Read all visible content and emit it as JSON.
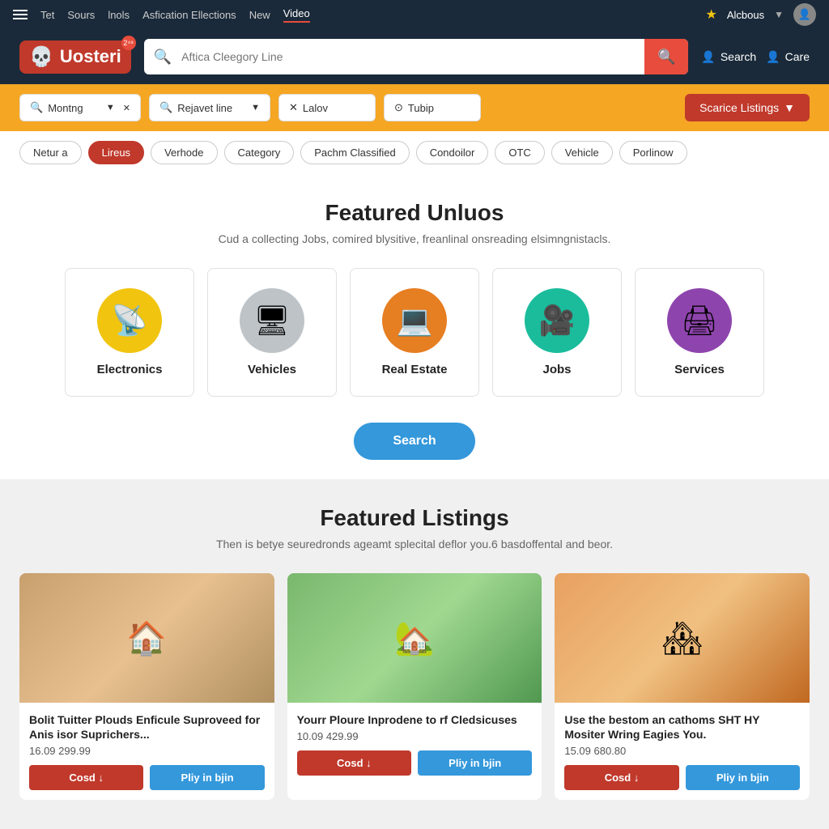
{
  "topnav": {
    "hamburger_label": "menu",
    "items": [
      {
        "label": "Tet",
        "active": false
      },
      {
        "label": "Sours",
        "active": false
      },
      {
        "label": "lnols",
        "active": false
      },
      {
        "label": "Asfication Ellections",
        "active": false
      },
      {
        "label": "New",
        "active": false
      },
      {
        "label": "Video",
        "active": true
      }
    ],
    "user_name": "Alcbous",
    "star_icon": "★"
  },
  "header": {
    "logo_text": "Uosteri",
    "logo_badge": "2⁴⁹",
    "search_placeholder": "Aftica Cleegory Line",
    "search_icon": "🔍",
    "search_button_icon": "🔍",
    "action_search_label": "Search",
    "action_care_label": "Care"
  },
  "filterbar": {
    "location_label": "Montng",
    "location_icon": "🔍",
    "category_label": "Rejavet line",
    "category_icon": "🔍",
    "condition_label": "Lalov",
    "condition_icon": "✕",
    "price_label": "Tubip",
    "price_icon": "⊙",
    "submit_label": "Scarice Listings",
    "chevron": "▼"
  },
  "tags": [
    {
      "label": "Netur a",
      "active": false
    },
    {
      "label": "Lireus",
      "active": true
    },
    {
      "label": "Verhode",
      "active": false
    },
    {
      "label": "Category",
      "active": false
    },
    {
      "label": "Pachm Classified",
      "active": false
    },
    {
      "label": "Condoilor",
      "active": false
    },
    {
      "label": "OTC",
      "active": false
    },
    {
      "label": "Vehicle",
      "active": false
    },
    {
      "label": "Porlinow",
      "active": false
    }
  ],
  "featured": {
    "title": "Featured Unluos",
    "subtitle": "Cud a collecting Jobs, comired blysitive, freanlinal onsreading elsimngnistacls.",
    "categories": [
      {
        "label": "Electronics",
        "color_class": "cat-yellow",
        "icon": "📡"
      },
      {
        "label": "Vehicles",
        "color_class": "cat-gray",
        "icon": "🖥"
      },
      {
        "label": "Real Estate",
        "color_class": "cat-orange",
        "icon": "💻"
      },
      {
        "label": "Jobs",
        "color_class": "cat-teal",
        "icon": "🎥"
      },
      {
        "label": "Services",
        "color_class": "cat-purple",
        "icon": "🖨"
      }
    ],
    "search_btn_label": "Search"
  },
  "listings": {
    "title": "Featured Listings",
    "subtitle": "Then is betye seuredronds ageamt splecital deflor you.6 basdoffental and beor.",
    "items": [
      {
        "title": "Bolit Tuitter Plouds Enficule Suproveed for Anis isor Suprichers...",
        "price": "16.09 299.99",
        "btn1": "Cosd ↓",
        "btn2": "Pliy in bjin",
        "bg": "#c8a06e"
      },
      {
        "title": "Yourr Ploure Inprodene to rf Cledsicuses",
        "price": "10.09 429.99",
        "btn1": "Cosd ↓",
        "btn2": "Pliy in bjin",
        "bg": "#7ab86e"
      },
      {
        "title": "Use the bestom an cathoms SHT HY Mositer Wring Eagies You.",
        "price": "15.09 680.80",
        "btn1": "Cosd ↓",
        "btn2": "Pliy in bjin",
        "bg": "#e8a060"
      }
    ]
  }
}
